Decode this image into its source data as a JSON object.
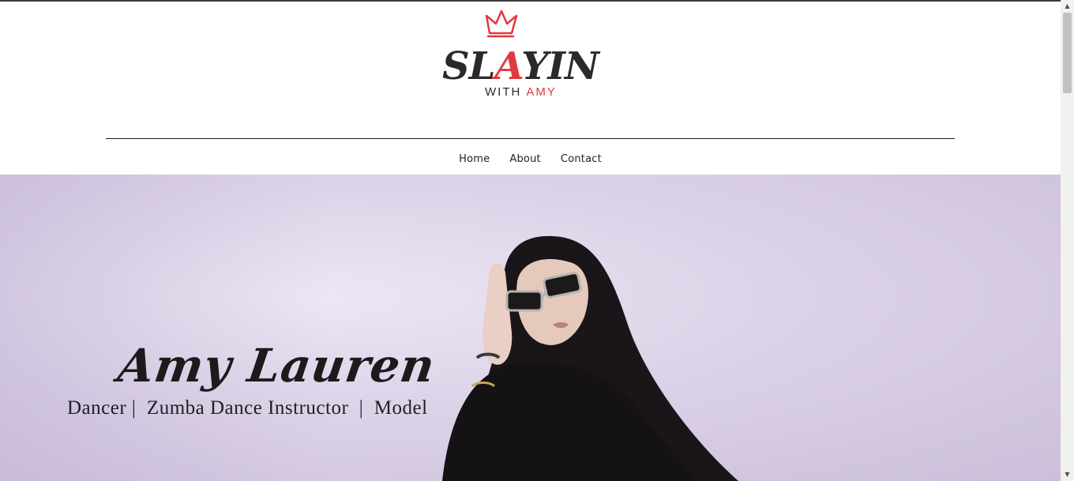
{
  "logo": {
    "main_text": "SLAYIN",
    "sub_text_prefix": "WITH",
    "sub_text_accent": "AMY",
    "accent_color": "#e03a3e"
  },
  "nav": {
    "items": [
      {
        "label": "Home"
      },
      {
        "label": "About"
      },
      {
        "label": "Contact"
      }
    ]
  },
  "hero": {
    "name": "Amy Lauren",
    "subtitle": "Dancer |  Zumba Dance Instructor  |  Model"
  },
  "scrollbar": {
    "up_icon": "▲",
    "down_icon": "▼"
  }
}
